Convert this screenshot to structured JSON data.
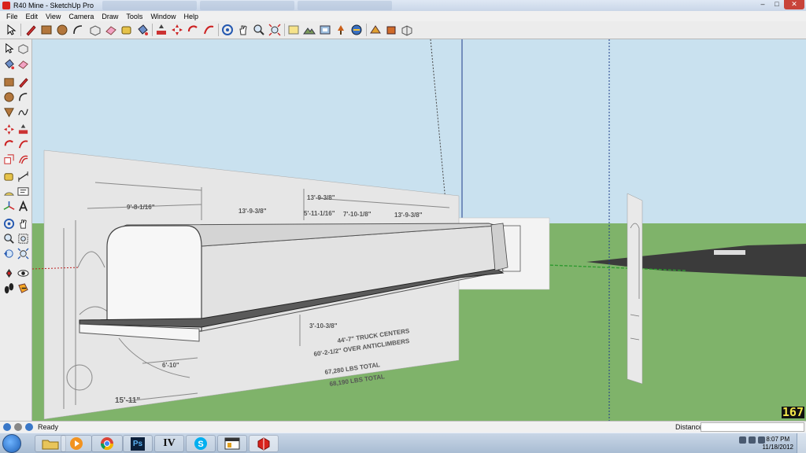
{
  "window": {
    "title": "R40 Mine - SketchUp Pro",
    "minimize": "–",
    "maximize": "□",
    "close": "✕"
  },
  "menu": [
    "File",
    "Edit",
    "View",
    "Camera",
    "Draw",
    "Tools",
    "Window",
    "Help"
  ],
  "viewport": {
    "fps_counter": "167",
    "colors": {
      "sky": "#c9e1ef",
      "ground": "#7fb36a",
      "drawing_panel": "#e8e8e8",
      "car_body": "#f2f2f2",
      "blue_axis": "#1d3b8a",
      "green_axis": "#2f9a2f"
    },
    "blueprint_text": {
      "dim_a": "9'-8-1/16\"",
      "dim_b": "13'-9-3/8\"",
      "dim_c": "13'-9-3/8\"",
      "dim_d": "5'-11-1/16\"",
      "dim_e": "7'-10-1/8\"",
      "dim_f": "13'-9-3/8\"",
      "dim_g": "3'-10-3/8\"",
      "dim_h": "6'-10\"",
      "dim_i": "15'-11\"",
      "note_1": "44'-7\" TRUCK CENTERS",
      "note_2": "60'-2-1/2\" OVER ANTICLIMBERS",
      "note_3": "67,280 LBS TOTAL",
      "note_4": "68,190 LBS TOTAL"
    }
  },
  "status": {
    "text": "Ready",
    "distance_label": "Distance",
    "distance_value": ""
  },
  "taskbar": {
    "apps": [
      "folder-icon",
      "media-player-icon",
      "chrome-icon",
      "photoshop-icon",
      "gta-iv-icon",
      "skype-icon",
      "window-icon",
      "sketchup-icon"
    ],
    "ps_label": "Ps",
    "iv_label": "IV",
    "time": "8:07 PM",
    "date": "11/18/2012"
  }
}
